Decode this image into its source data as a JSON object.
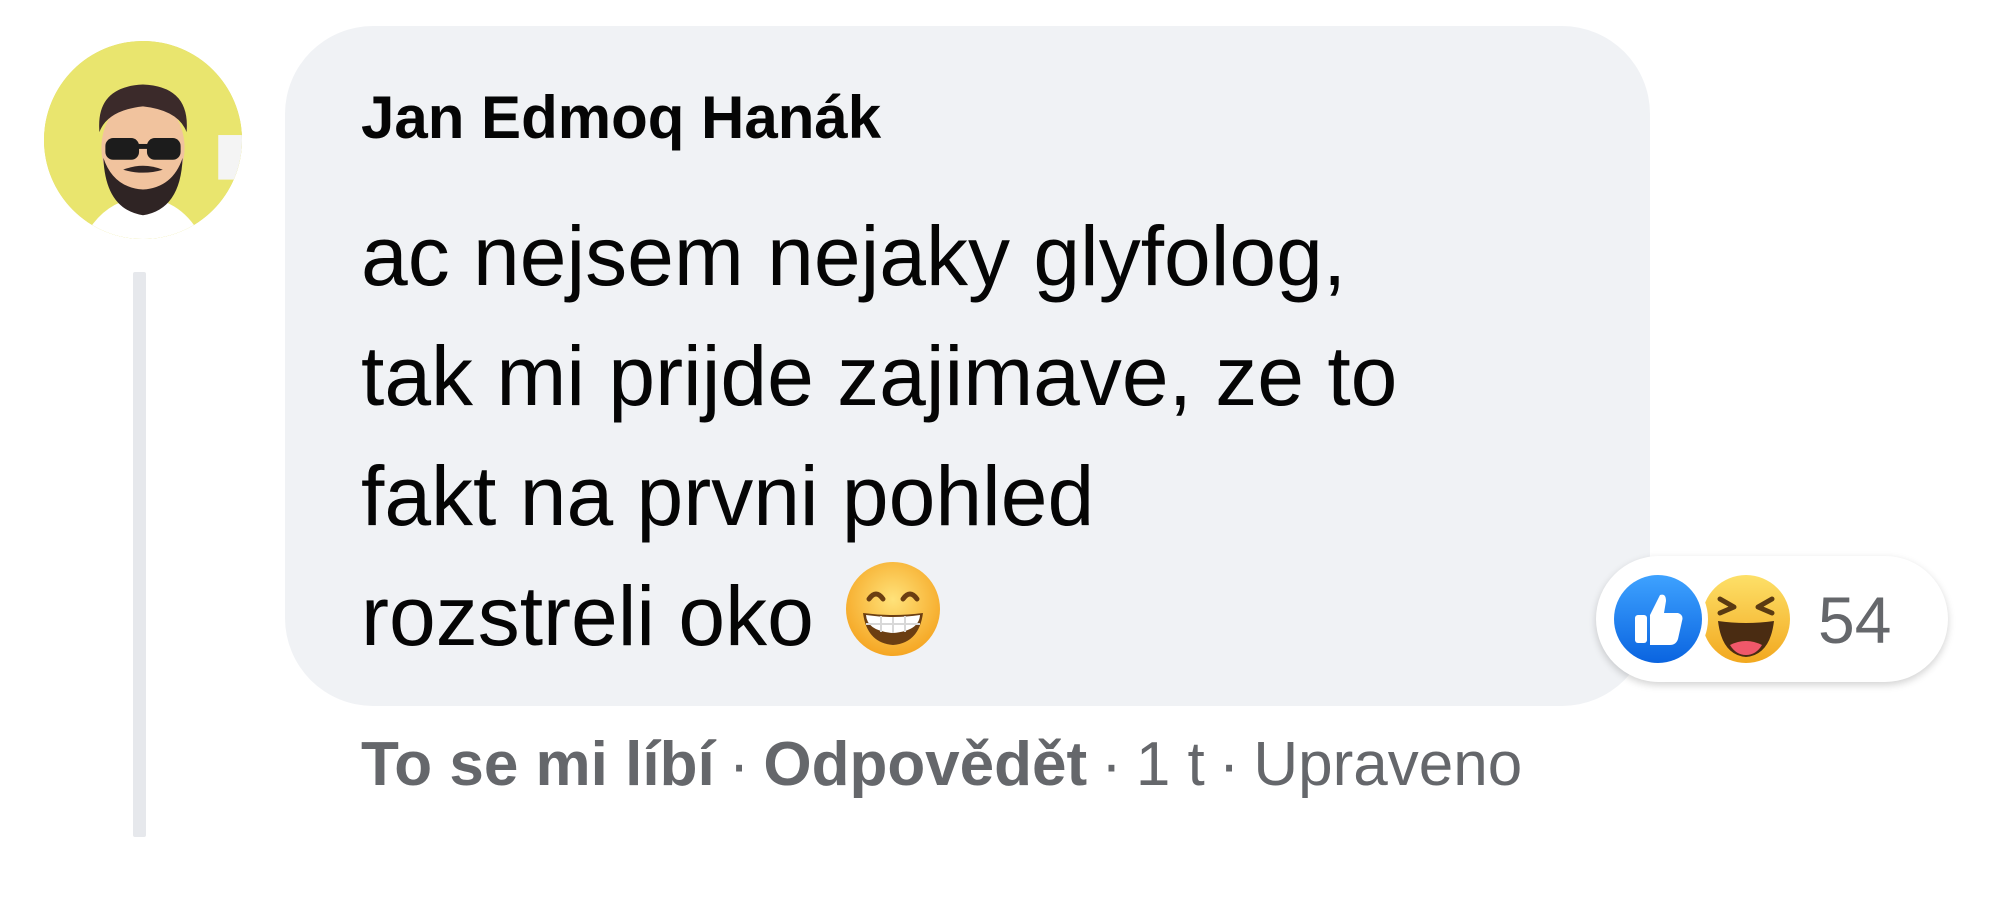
{
  "comment": {
    "author": "Jan Edmoq Hanák",
    "lines": [
      "ac nejsem nejaky glyfolog,",
      "tak mi prijde zajimave, ze to",
      "fakt na prvni pohled",
      "rozstreli oko"
    ],
    "emoji": "grinning-face-with-smiling-eyes"
  },
  "reactions": {
    "types": [
      "like",
      "haha"
    ],
    "count": "54"
  },
  "actions": {
    "like_label": "To se mi líbí",
    "reply_label": "Odpovědět",
    "time": "1 t",
    "edited_label": "Upraveno",
    "separator": "·"
  },
  "colors": {
    "bubble": "#f0f2f5",
    "text": "#050505",
    "secondary_text": "#65676b",
    "like_blue": "#1877f2",
    "haha_yellow": "#f7b928"
  }
}
